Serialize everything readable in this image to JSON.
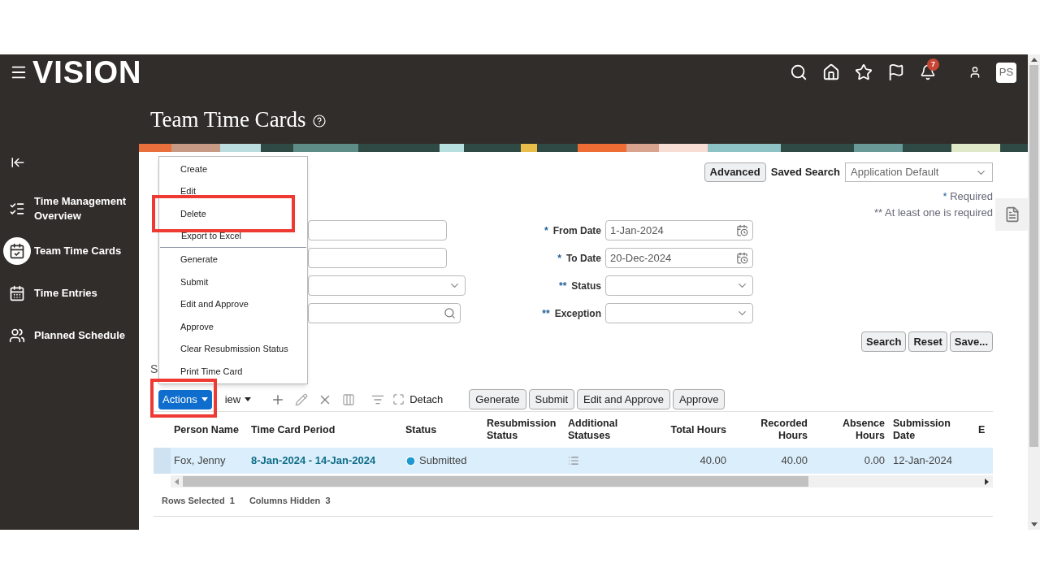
{
  "header": {
    "logo": "VISION",
    "notification_count": "7",
    "user_initials": "PS"
  },
  "sidebar": {
    "items": [
      {
        "label": "Time Management Overview",
        "selected": false
      },
      {
        "label": "Team Time Cards",
        "selected": true
      },
      {
        "label": "Time Entries",
        "selected": false
      },
      {
        "label": "Planned Schedule",
        "selected": false
      }
    ]
  },
  "page": {
    "title": "Team Time Cards"
  },
  "search": {
    "advanced_button": "Advanced",
    "saved_search_label": "Saved Search",
    "saved_search_value": "Application Default",
    "required_note": "Required",
    "required_mark": "*",
    "at_least_one_note": "** At least one is required",
    "left_fields": [
      {
        "kind": "text"
      },
      {
        "kind": "text"
      },
      {
        "kind": "select"
      },
      {
        "kind": "search"
      }
    ],
    "right_fields": [
      {
        "mark": "*",
        "label": "From Date",
        "value": "1-Jan-2024",
        "kind": "date"
      },
      {
        "mark": "*",
        "label": "To Date",
        "value": "20-Dec-2024",
        "kind": "date"
      },
      {
        "mark": "**",
        "label": "Status",
        "kind": "select"
      },
      {
        "mark": "**",
        "label": "Exception",
        "kind": "select"
      }
    ],
    "buttons": [
      "Search",
      "Reset",
      "Save..."
    ]
  },
  "results_heading": "S",
  "actions_menu": {
    "items": [
      {
        "label": "Create",
        "highlighted": false,
        "divider_after": false
      },
      {
        "label": "Edit",
        "highlighted": false,
        "divider_after": false
      },
      {
        "label": "Delete",
        "highlighted": true,
        "divider_after": false
      },
      {
        "label": "Export to Excel",
        "highlighted": false,
        "divider_after": true
      },
      {
        "label": "Generate",
        "highlighted": false,
        "divider_after": false
      },
      {
        "label": "Submit",
        "highlighted": false,
        "divider_after": false
      },
      {
        "label": "Edit and Approve",
        "highlighted": false,
        "divider_after": false
      },
      {
        "label": "Approve",
        "highlighted": false,
        "divider_after": false
      },
      {
        "label": "Clear Resubmission Status",
        "highlighted": false,
        "divider_after": false
      },
      {
        "label": "Print Time Card",
        "highlighted": false,
        "divider_after": false
      }
    ]
  },
  "toolbar": {
    "actions": "Actions",
    "actions_highlighted": true,
    "view": "iew",
    "detach": "Detach",
    "buttons": [
      "Generate",
      "Submit",
      "Edit and Approve",
      "Approve"
    ]
  },
  "table": {
    "columns": [
      "Person Name",
      "Time Card Period",
      "Status",
      "Resubmission Status",
      "Additional Statuses",
      "Total Hours",
      "Recorded Hours",
      "Absence Hours",
      "Submission Date",
      "E"
    ],
    "rows": [
      {
        "selected": true,
        "person": "Fox, Jenny",
        "period": "8-Jan-2024 - 14-Jan-2024",
        "status": "Submitted",
        "total": "40.00",
        "recorded": "40.00",
        "absence": "0.00",
        "submission_date": "12-Jan-2024"
      }
    ]
  },
  "footer": {
    "rows_selected_label": "Rows Selected",
    "rows_selected": "1",
    "columns_hidden_label": "Columns Hidden",
    "columns_hidden": "3"
  }
}
